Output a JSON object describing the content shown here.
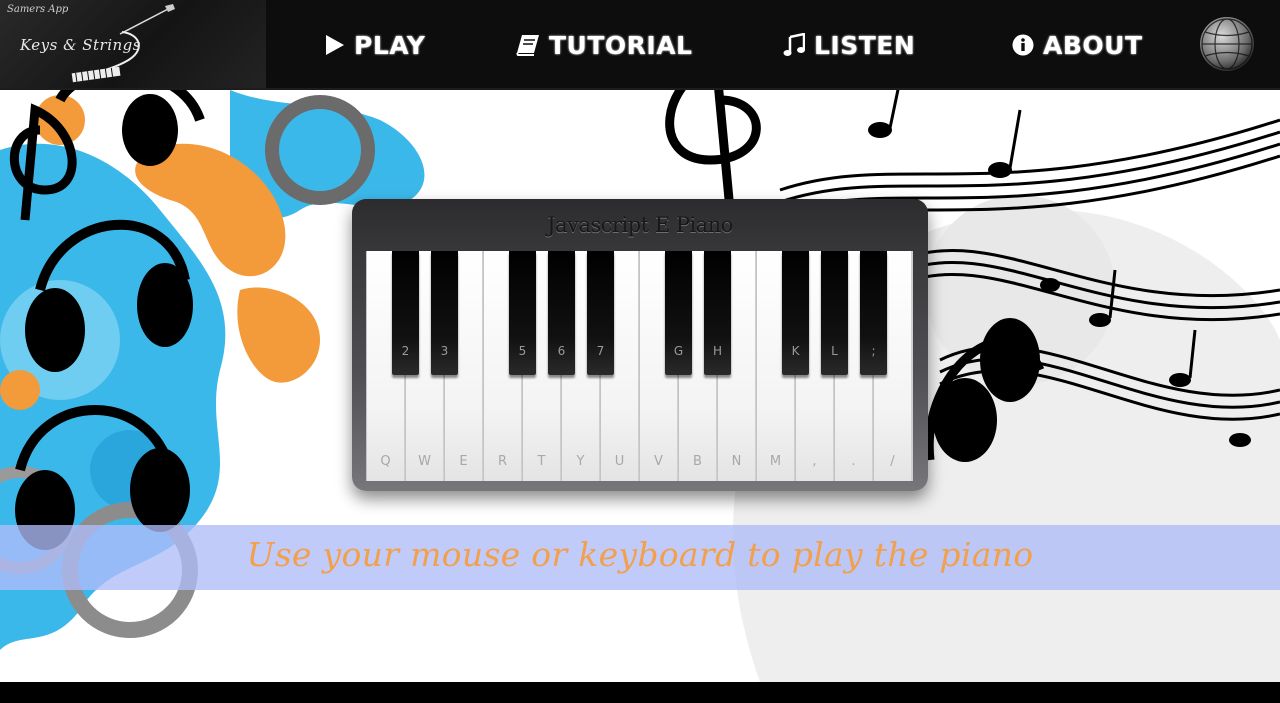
{
  "logo": {
    "small": "Samers App",
    "main": "Keys & Strings"
  },
  "nav": {
    "play": "PLAY",
    "tutorial": "TUTORIAL",
    "listen": "LISTEN",
    "about": "ABOUT",
    "icons": {
      "play": "play-icon",
      "tutorial": "book-icon",
      "listen": "music-note-icon",
      "about": "info-icon",
      "profile": "globe-icon"
    }
  },
  "piano": {
    "title": "Javascript E Piano",
    "white_keys": [
      "Q",
      "W",
      "E",
      "R",
      "T",
      "Y",
      "U",
      "V",
      "B",
      "N",
      "M",
      ",",
      ".",
      "/"
    ],
    "black_keys": [
      "2",
      "3",
      "5",
      "6",
      "7",
      "G",
      "H",
      "K",
      "L",
      ";"
    ]
  },
  "banner": {
    "text": "Use your mouse or keyboard to play the piano"
  },
  "colors": {
    "navbar": "#0d0d0d",
    "banner_bg": "#b0bcf8",
    "banner_text": "#f2a04b",
    "splash_blue": "#3bb8ea",
    "splash_orange": "#f39a3a"
  }
}
